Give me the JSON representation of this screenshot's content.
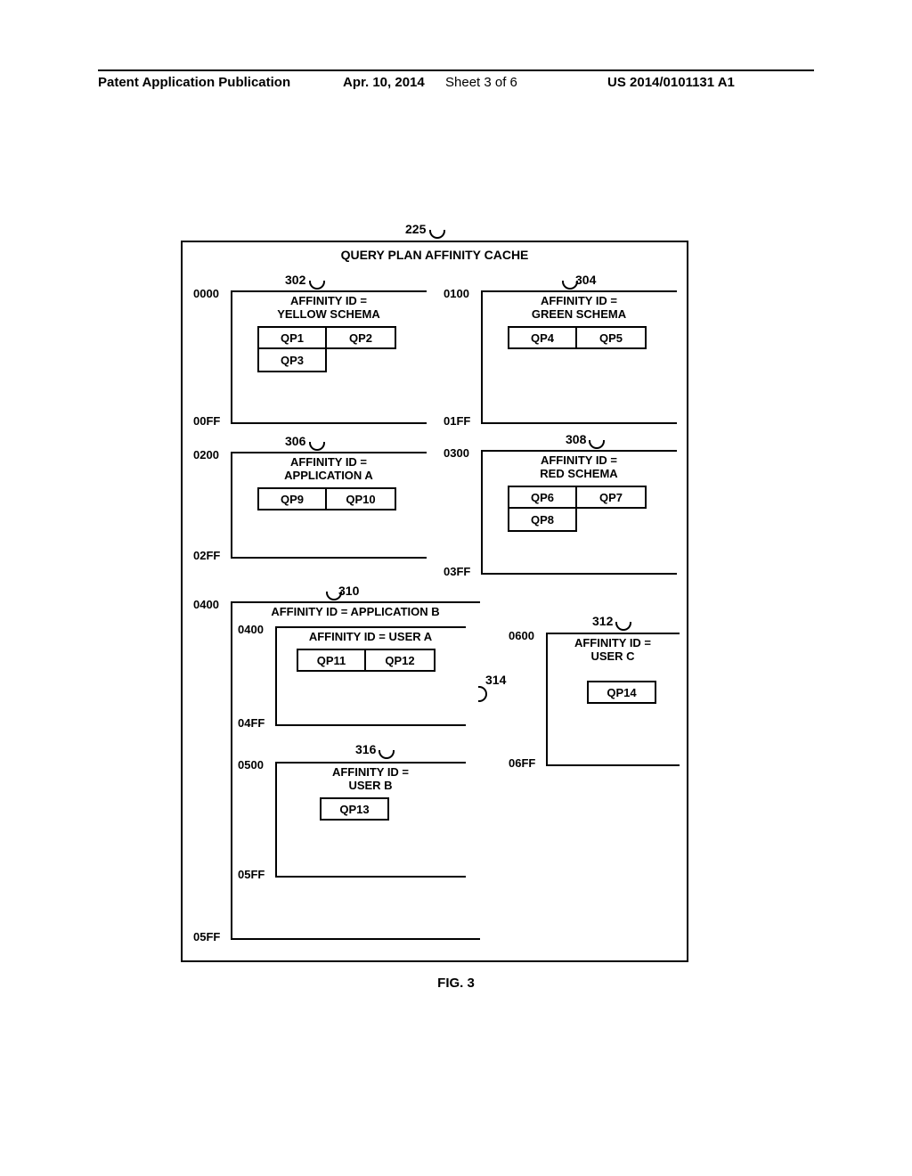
{
  "header": {
    "left": "Patent Application Publication",
    "mid": "Apr. 10, 2014",
    "sheet": "Sheet 3 of 6",
    "right": "US 2014/0101131 A1"
  },
  "cache": {
    "ref": "225",
    "title": "QUERY PLAN AFFINITY CACHE"
  },
  "blocks": {
    "b302": {
      "ref": "302",
      "addrTop": "0000",
      "addrBot": "00FF",
      "title1": "AFFINITY ID =",
      "title2": "YELLOW SCHEMA",
      "qp": [
        "QP1",
        "QP2",
        "QP3"
      ]
    },
    "b304": {
      "ref": "304",
      "addrTop": "0100",
      "addrBot": "01FF",
      "title1": "AFFINITY ID =",
      "title2": "GREEN SCHEMA",
      "qp": [
        "QP4",
        "QP5"
      ]
    },
    "b306": {
      "ref": "306",
      "addrTop": "0200",
      "addrBot": "02FF",
      "title1": "AFFINITY ID =",
      "title2": "APPLICATION A",
      "qp": [
        "QP9",
        "QP10"
      ]
    },
    "b308": {
      "ref": "308",
      "addrTop": "0300",
      "addrBot": "03FF",
      "title1": "AFFINITY ID =",
      "title2": "RED SCHEMA",
      "qp": [
        "QP6",
        "QP7",
        "QP8"
      ]
    },
    "b310": {
      "ref": "310",
      "addrTop": "0400",
      "addrBot": "05FF",
      "title": "AFFINITY ID = APPLICATION B"
    },
    "b314": {
      "ref": "314",
      "addrTop": "0400",
      "addrBot": "04FF",
      "title": "AFFINITY ID = USER A",
      "qp": [
        "QP11",
        "QP12"
      ]
    },
    "b316": {
      "ref": "316",
      "addrTop": "0500",
      "addrBot": "05FF",
      "title1": "AFFINITY ID =",
      "title2": "USER B",
      "qp": [
        "QP13"
      ]
    },
    "b312": {
      "ref": "312",
      "addrTop": "0600",
      "addrBot": "06FF",
      "title1": "AFFINITY ID =",
      "title2": "USER C",
      "qp": [
        "QP14"
      ]
    }
  },
  "figure": "FIG. 3"
}
